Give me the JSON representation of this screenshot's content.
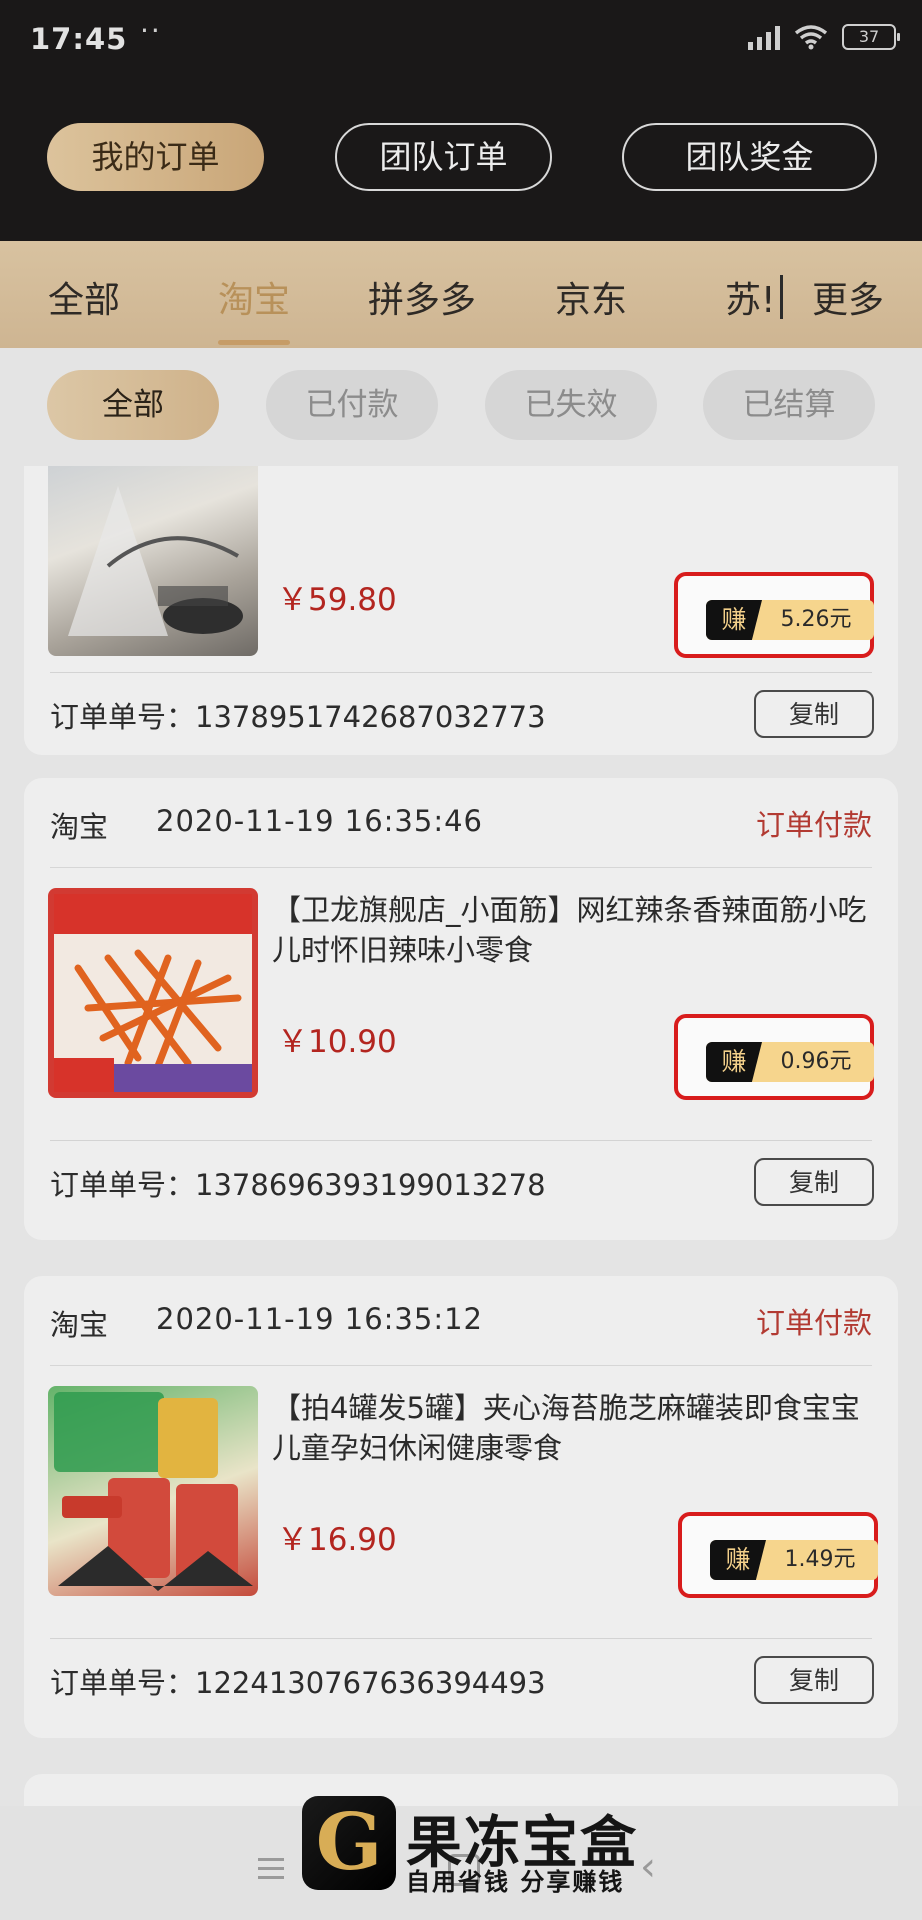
{
  "status_bar": {
    "time": "17:45",
    "dots": "··",
    "battery": "37"
  },
  "top_tabs": [
    "我的订单",
    "团队订单",
    "团队奖金"
  ],
  "platform_tabs": [
    "全部",
    "淘宝",
    "拼多多",
    "京东",
    "苏!"
  ],
  "platform_more": "更多",
  "status_filters": [
    "全部",
    "已付款",
    "已失效",
    "已结算"
  ],
  "labels": {
    "order_no": "订单单号：",
    "copy": "复制",
    "earn": "赚"
  },
  "orders": [
    {
      "price": "￥59.80",
      "earn": "5.26元",
      "order_no": "1378951742687032773"
    },
    {
      "platform": "淘宝",
      "datetime": "2020-11-19 16:35:46",
      "status": "订单付款",
      "title": "【卫龙旗舰店_小面筋】网红辣条香辣面筋小吃儿时怀旧辣味小零食",
      "price": "￥10.90",
      "earn": "0.96元",
      "order_no": "1378696393199013278"
    },
    {
      "platform": "淘宝",
      "datetime": "2020-11-19 16:35:12",
      "status": "订单付款",
      "title": "【拍4罐发5罐】夹心海苔脆芝麻罐装即食宝宝儿童孕妇休闲健康零食",
      "price": "￥16.90",
      "earn": "1.49元",
      "order_no": "1224130767636394493"
    }
  ],
  "watermark": {
    "logo_letter": "G",
    "name": "果冻宝盒",
    "slogan": "自用省钱 分享赚钱"
  },
  "colors": {
    "accent_gold": "#c9a678",
    "status_red": "#b23a32",
    "highlight_red": "#d81c1c"
  }
}
